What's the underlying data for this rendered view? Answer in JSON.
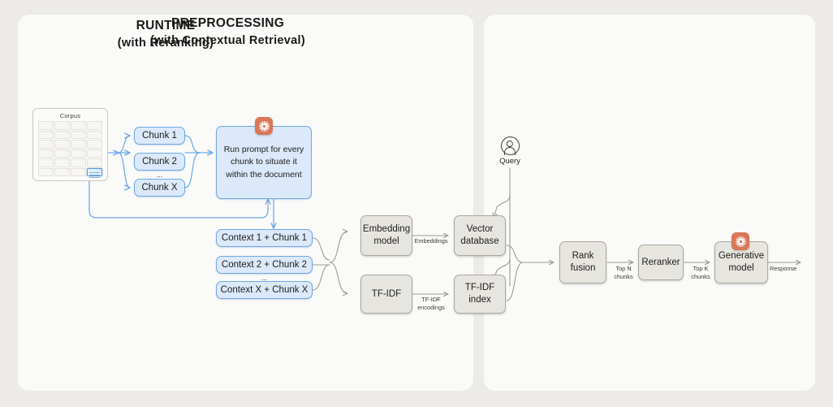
{
  "panels": {
    "preprocessing": {
      "title": "PREPROCESSING",
      "subtitle": "(with Contextual Retrieval)"
    },
    "runtime": {
      "title": "RUNTIME",
      "subtitle": "(with Reranking)"
    }
  },
  "corpus": {
    "label": "Corpus",
    "icon": "document-stack-icon",
    "highlighted_doc": "document-icon"
  },
  "chunks": [
    {
      "label": "Chunk 1"
    },
    {
      "label": "Chunk 2"
    },
    {
      "label": "Chunk X"
    }
  ],
  "chunks_ellipsis": "...",
  "prompt_box": {
    "text": "Run prompt for every chunk to situate it within the document",
    "badge": "spark-icon"
  },
  "contexts": [
    {
      "label": "Context 1 + Chunk 1"
    },
    {
      "label": "Context 2 + Chunk 2"
    },
    {
      "label": "Context X + Chunk X"
    }
  ],
  "contexts_ellipsis": "...",
  "nodes": {
    "embedding_model": "Embedding model",
    "tfidf": "TF-IDF",
    "vector_database": "Vector database",
    "tfidf_index": "TF-IDF index",
    "rank_fusion": "Rank fusion",
    "reranker": "Reranker",
    "generative_model": "Generative model"
  },
  "query": {
    "label": "Query",
    "icon": "user-circle-icon"
  },
  "edge_labels": {
    "embeddings": "Embeddings",
    "tfidf_encodings": "TF-IDF\nencodings",
    "top_n_chunks": "Top N\nchunks",
    "top_k_chunks": "Top K\nchunks",
    "response": "Response"
  },
  "colors": {
    "page_background": "#EDEBE7",
    "panel_background": "#FAFAF8",
    "blue_node_fill": "#DBE9FA",
    "blue_node_border": "#6FA8E8",
    "gray_node_fill": "#E7E5DF",
    "gray_node_border": "#A9A79F",
    "accent_orange": "#D97757",
    "wire_gray": "#9C9A93",
    "wire_blue": "#6FA8E8"
  }
}
